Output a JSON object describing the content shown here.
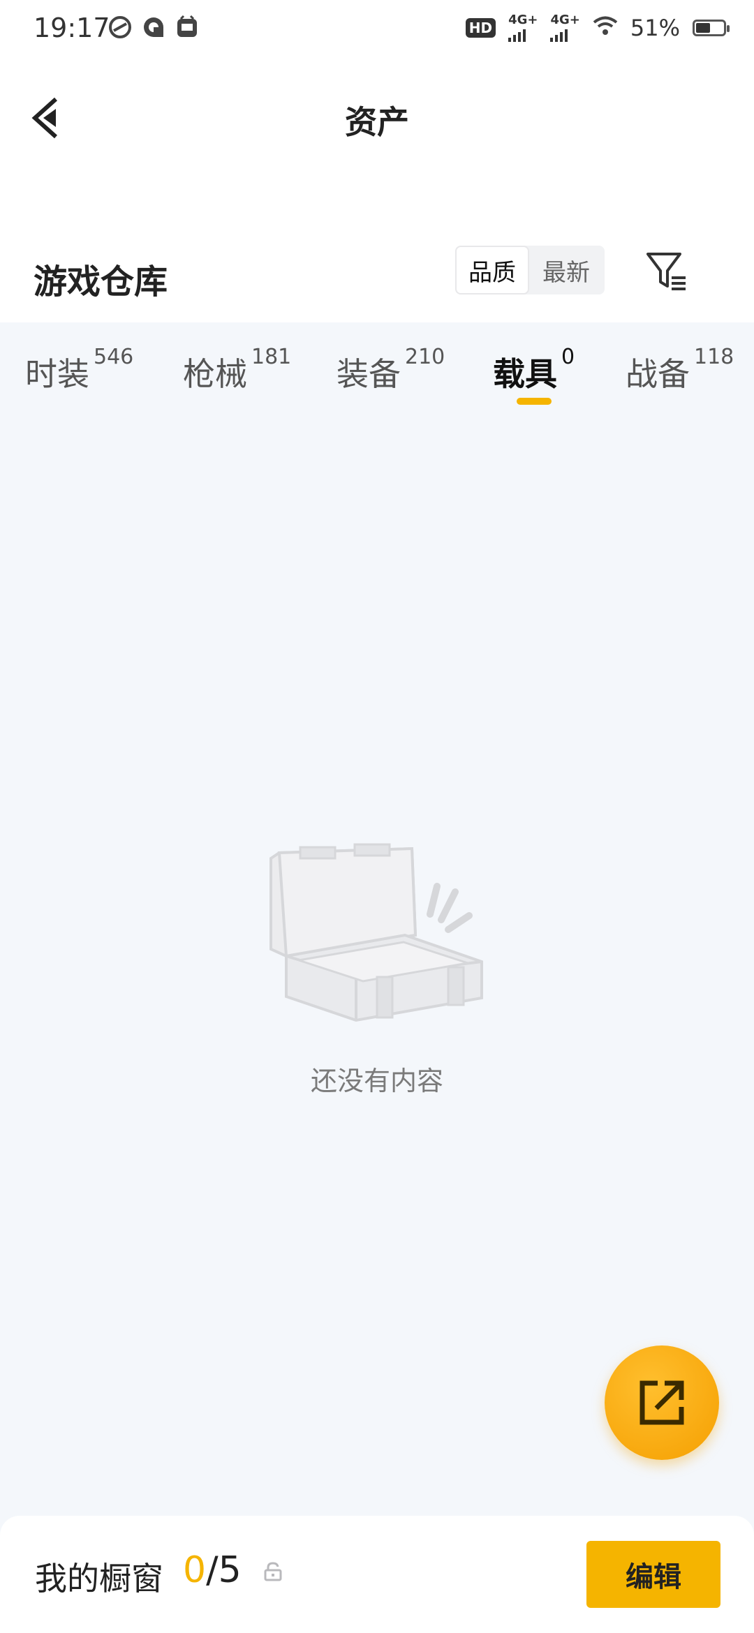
{
  "status_bar": {
    "time": "19:17",
    "hd_label": "HD",
    "network_1": "4G+",
    "network_2": "4G+",
    "battery": "51%"
  },
  "header": {
    "title": "资产"
  },
  "section": {
    "title": "游戏仓库",
    "sort_options": [
      {
        "label": "品质",
        "active": true
      },
      {
        "label": "最新",
        "active": false
      }
    ]
  },
  "tabs": [
    {
      "label": "时装",
      "count": "546",
      "active": false
    },
    {
      "label": "枪械",
      "count": "181",
      "active": false
    },
    {
      "label": "装备",
      "count": "210",
      "active": false
    },
    {
      "label": "载具",
      "count": "0",
      "active": true
    },
    {
      "label": "战备",
      "count": "118",
      "active": false
    }
  ],
  "empty_state": {
    "message": "还没有内容",
    "icon": "empty-crate-icon"
  },
  "fab": {
    "icon": "share-icon"
  },
  "bottom_bar": {
    "label": "我的橱窗",
    "current": "0",
    "separator": "/",
    "max": "5",
    "edit_label": "编辑"
  },
  "colors": {
    "accent": "#f5b400",
    "background": "#f4f7fb"
  }
}
